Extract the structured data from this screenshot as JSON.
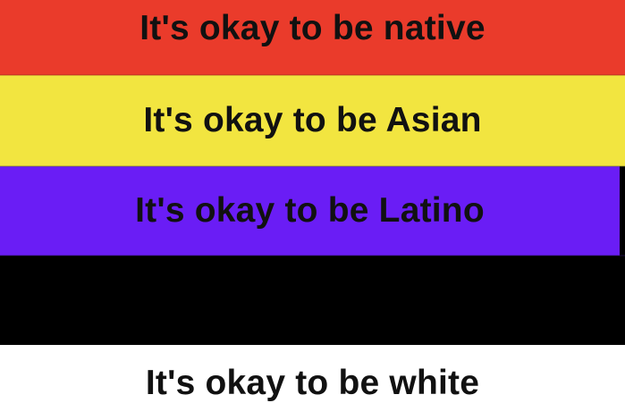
{
  "colors": {
    "red": "#ea3b2b",
    "yellow": "#f2e540",
    "purple": "#6a1df5",
    "black": "#000000",
    "white": "#ffffff",
    "text": "#111111"
  },
  "stripes": [
    {
      "color": "red",
      "text": "It's okay to be native"
    },
    {
      "color": "yellow",
      "text": "It's okay to be Asian"
    },
    {
      "color": "purple",
      "text": "It's okay to be Latino"
    },
    {
      "color": "black",
      "text": ""
    },
    {
      "color": "white",
      "text": "It's okay to be white"
    }
  ]
}
